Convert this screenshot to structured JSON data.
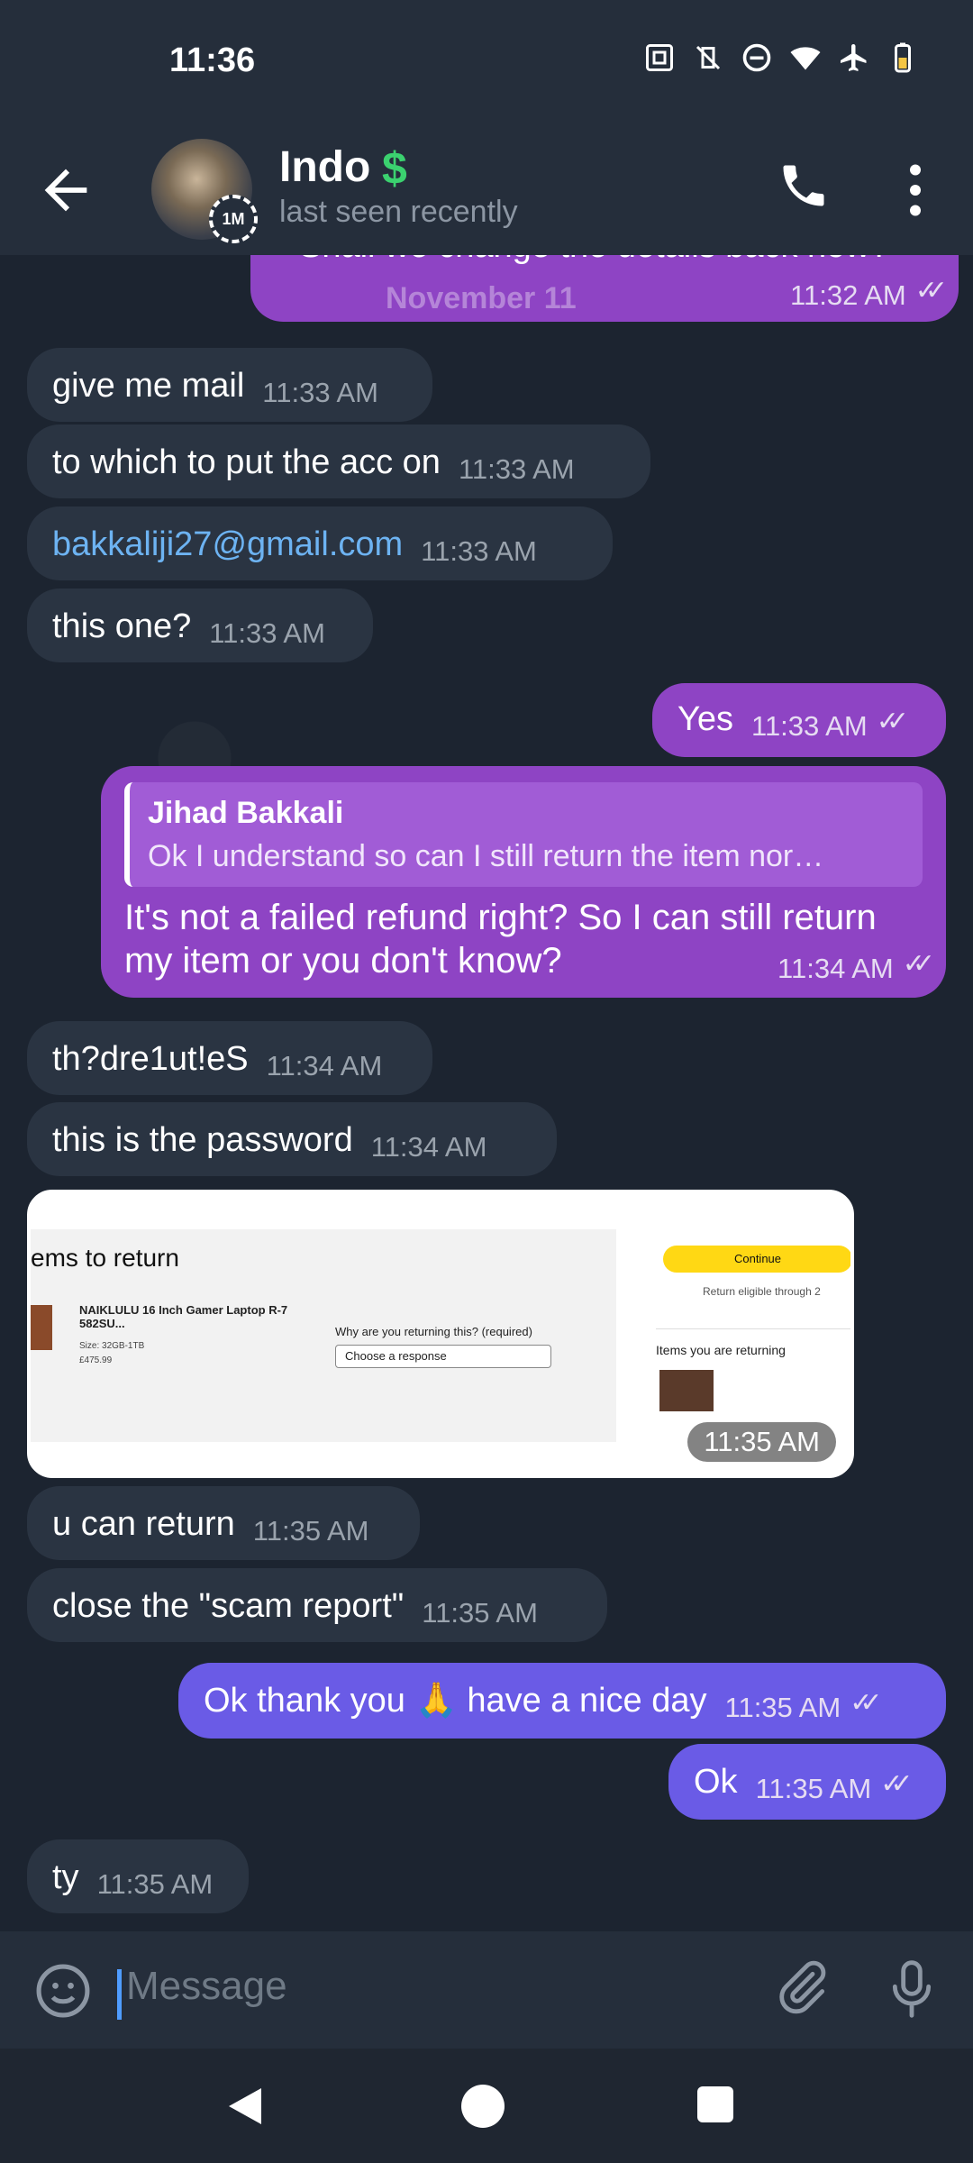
{
  "status_bar": {
    "time": "11:36"
  },
  "header": {
    "name": "Indo",
    "status": "last seen recently",
    "story_badge": "1M"
  },
  "date_badge": "November 11",
  "messages": [
    {
      "dir": "out",
      "text": "Shall we change the details back now?",
      "time": "11:32 AM"
    },
    {
      "dir": "in",
      "text": "give me mail",
      "time": "11:33 AM"
    },
    {
      "dir": "in",
      "text": "to which to put the acc on",
      "time": "11:33 AM"
    },
    {
      "dir": "in",
      "text": "bakkaliji27@gmail.com",
      "time": "11:33 AM"
    },
    {
      "dir": "in",
      "text": "this one?",
      "time": "11:33 AM"
    },
    {
      "dir": "out",
      "text": "Yes",
      "time": "11:33 AM"
    },
    {
      "dir": "out",
      "reply_to": {
        "name": "Jihad Bakkali",
        "text": "Ok I understand so can I still return the item nor…"
      },
      "text_line1": "It's not a failed refund right? So I can still return",
      "text_line2": "my item or you don't know?",
      "time": "11:34 AM"
    },
    {
      "dir": "in",
      "text": "th?dre1ut!eS",
      "time": "11:34 AM"
    },
    {
      "dir": "in",
      "text": "this is the password",
      "time": "11:34 AM"
    },
    {
      "dir": "in",
      "type": "image",
      "time": "11:35 AM"
    },
    {
      "dir": "in",
      "text": "u can return",
      "time": "11:35 AM"
    },
    {
      "dir": "in",
      "text": "close the \"scam report\"",
      "time": "11:35 AM"
    },
    {
      "dir": "out",
      "text": "Ok thank you 🙏 have a nice day",
      "time": "11:35 AM"
    },
    {
      "dir": "out",
      "text": "Ok",
      "time": "11:35 AM"
    },
    {
      "dir": "in",
      "text": "ty",
      "time": "11:35 AM"
    }
  ],
  "screenshot_image": {
    "heading": "ems to return",
    "product_name_line1": "NAIKLULU 16 Inch Gamer Laptop R-7",
    "product_name_line2": "582SU...",
    "size": "Size: 32GB-1TB",
    "price": "£475.99",
    "question": "Why are you returning this? (required)",
    "select_value": "Choose a response",
    "continue_label": "Continue",
    "eligible_text": "Return eligible through 2",
    "returning_label": "Items you are returning"
  },
  "composer": {
    "placeholder": "Message"
  },
  "colors": {
    "outgoing": "#8e44c4",
    "outgoing_recent": "#6a5be6",
    "incoming": "#2a3442",
    "link": "#6db3f2"
  }
}
